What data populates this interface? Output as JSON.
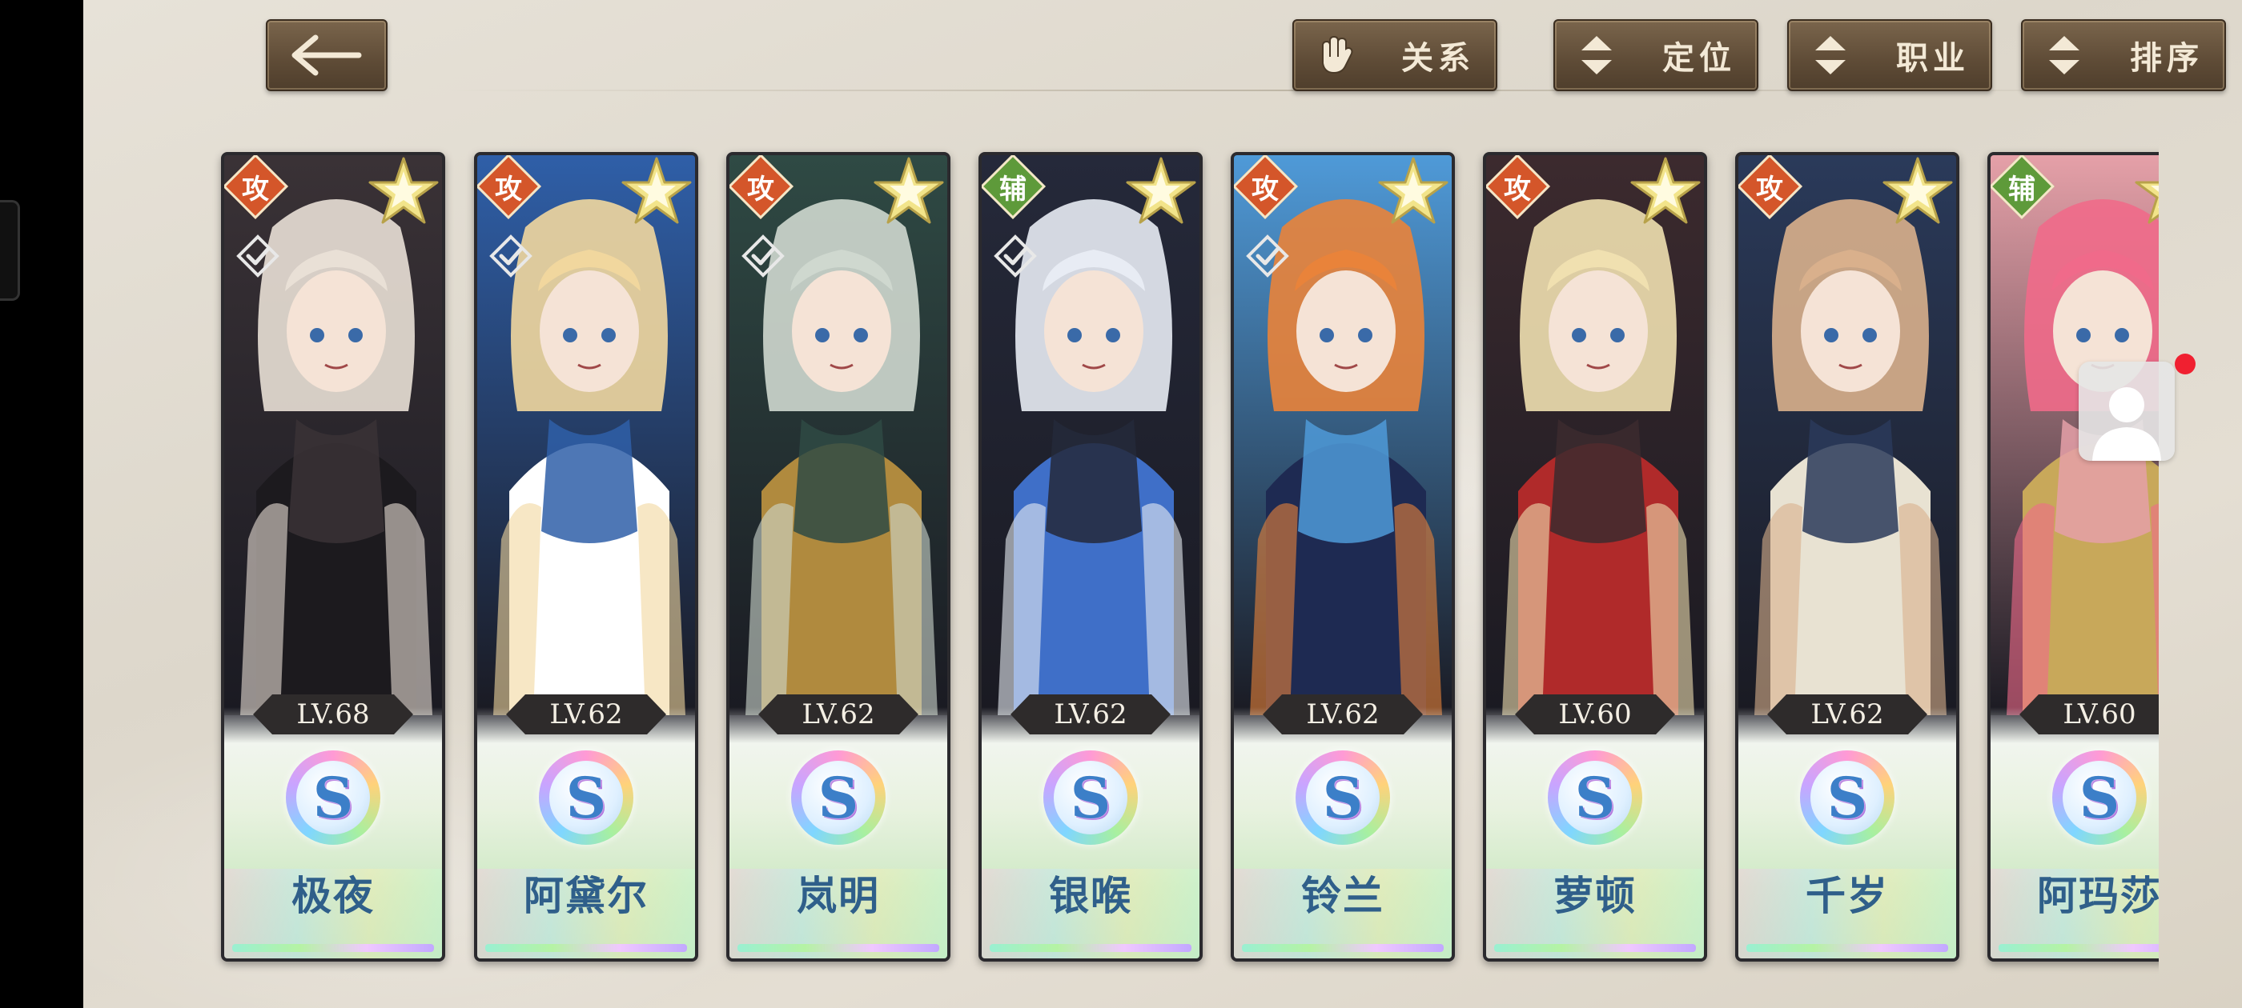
{
  "toolbar": {
    "back_icon": "arrow-left-icon",
    "buttons": [
      {
        "label": "关系",
        "icon": "glove-icon"
      },
      {
        "label": "定位",
        "icon": "sort-arrows-icon"
      },
      {
        "label": "职业",
        "icon": "sort-arrows-icon"
      },
      {
        "label": "排序",
        "icon": "sort-arrows-icon"
      }
    ]
  },
  "colors": {
    "attack_badge": "#d4562a",
    "support_badge": "#5e9a3a",
    "button_bg": "#5e4b36",
    "name_text": "#2f5f8a",
    "star": "#f2e48a"
  },
  "characters": [
    {
      "role": "攻",
      "level": "LV.68",
      "rank": "S",
      "name": "极夜",
      "checked": true,
      "palette": [
        "#3a3236",
        "#e9e0d6",
        "#1c1a1e"
      ]
    },
    {
      "role": "攻",
      "level": "LV.62",
      "rank": "S",
      "name": "阿黛尔",
      "checked": true,
      "palette": [
        "#2f5fa8",
        "#f1d79e",
        "#ffffff"
      ]
    },
    {
      "role": "攻",
      "level": "LV.62",
      "rank": "S",
      "name": "岚明",
      "checked": true,
      "palette": [
        "#2f4a44",
        "#cfd8cf",
        "#b08a3e"
      ]
    },
    {
      "role": "辅",
      "level": "LV.62",
      "rank": "S",
      "name": "银喉",
      "checked": true,
      "palette": [
        "#25293a",
        "#e8ecf4",
        "#3f6fc8"
      ]
    },
    {
      "role": "攻",
      "level": "LV.62",
      "rank": "S",
      "name": "铃兰",
      "checked": true,
      "palette": [
        "#4f9ad8",
        "#e9833a",
        "#1e2a52"
      ]
    },
    {
      "role": "攻",
      "level": "LV.60",
      "rank": "S",
      "name": "萝顿",
      "checked": false,
      "palette": [
        "#3c2a2e",
        "#f0e0b0",
        "#b02a2a"
      ]
    },
    {
      "role": "攻",
      "level": "LV.62",
      "rank": "S",
      "name": "千岁",
      "checked": false,
      "palette": [
        "#2a3a5a",
        "#d9b08c",
        "#e8e2d2"
      ]
    },
    {
      "role": "辅",
      "level": "LV.60",
      "rank": "S",
      "name": "阿玛莎",
      "checked": false,
      "palette": [
        "#e5a0a8",
        "#f06a8a",
        "#c8a85a"
      ]
    }
  ],
  "floating_avatar": {
    "icon": "user-avatar-icon",
    "notification": true
  }
}
